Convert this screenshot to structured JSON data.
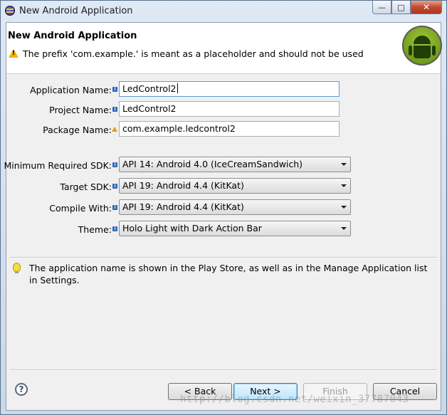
{
  "window": {
    "title": "New Android Application",
    "icon": "eclipse-icon"
  },
  "header": {
    "title": "New Android Application",
    "message": "The prefix 'com.example.' is meant as a placeholder and should not be used"
  },
  "form": {
    "app_name_label": "Application Name:",
    "app_name_value": "LedControl2",
    "project_name_label": "Project Name:",
    "project_name_value": "LedControl2",
    "package_name_label": "Package Name:",
    "package_name_value": "com.example.ledcontrol2",
    "min_sdk_label": "Minimum Required SDK:",
    "min_sdk_value": "API 14: Android 4.0 (IceCreamSandwich)",
    "target_sdk_label": "Target SDK:",
    "target_sdk_value": "API 19: Android 4.4 (KitKat)",
    "compile_with_label": "Compile With:",
    "compile_with_value": "API 19: Android 4.4 (KitKat)",
    "theme_label": "Theme:",
    "theme_value": "Holo Light with Dark Action Bar"
  },
  "hint": {
    "text": "The application name is shown in the Play Store, as well as in the Manage Application list in Settings."
  },
  "buttons": {
    "help": "?",
    "back": "< Back",
    "next": "Next >",
    "finish": "Finish",
    "cancel": "Cancel"
  },
  "watermark": "http://blog.csdn.net/weixin_37787043"
}
